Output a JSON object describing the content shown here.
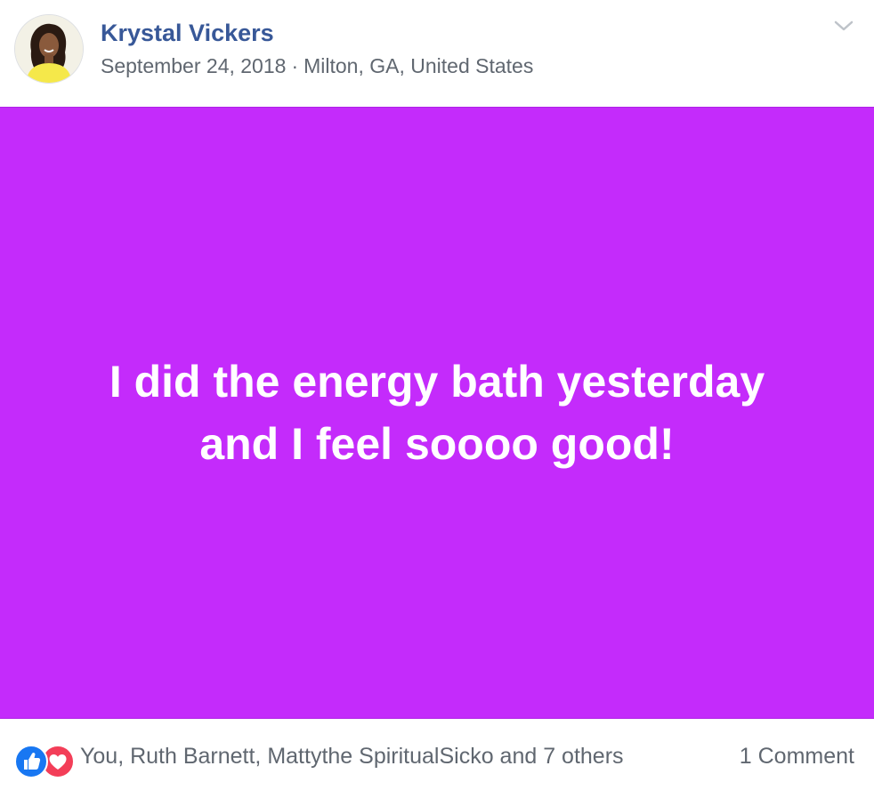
{
  "post": {
    "author": "Krystal Vickers",
    "date": "September 24, 2018",
    "separator": "·",
    "location": "Milton, GA, United States",
    "body_line_1": "I did the energy bath yesterday",
    "body_line_2": "and I feel soooo good!",
    "background_color": "#c42bfb"
  },
  "footer": {
    "reaction_icons": [
      "like-icon",
      "love-icon"
    ],
    "reactors_text": "You, Ruth Barnett, Mattythe SpiritualSicko and 7 others",
    "comments_text": "1 Comment"
  },
  "colors": {
    "name_link": "#385898",
    "meta_text": "#606770",
    "like_blue": "#1877f2",
    "love_red": "#f33e58"
  }
}
